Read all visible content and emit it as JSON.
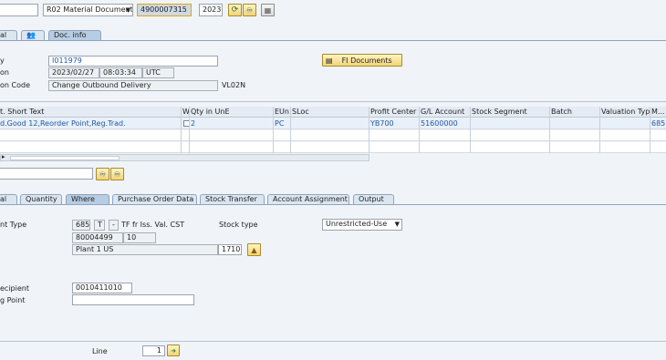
{
  "toolbar": {
    "action_value": "R02 Material Document",
    "document_number": "4900007315",
    "year": "2023"
  },
  "header_tabs": [
    {
      "label": "al"
    },
    {
      "label": ""
    },
    {
      "label": "Doc. info"
    }
  ],
  "doc_info": {
    "user_label": "y",
    "user_value": "I011979",
    "date_label": "on",
    "date_value": "2023/02/27",
    "time_value": "08:03:34",
    "tz_value": "UTC",
    "tcode_label": "on Code",
    "tcode_desc": "Change Outbound Delivery",
    "tcode": "VL02N",
    "fi_button": "FI Documents"
  },
  "items_table": {
    "columns": [
      "t. Short Text",
      "W",
      "Qty in UnE",
      "EUn",
      "SLoc",
      "Profit Center",
      "G/L Account",
      "Stock Segment",
      "Batch",
      "Valuation Type",
      "M..."
    ],
    "row": {
      "short_text": "d.Good 12,Reorder Point,Reg.Trad.",
      "qty": "2",
      "eun": "PC",
      "profit_center": "YB700",
      "gl_account": "51600000",
      "m": "685"
    }
  },
  "detail_tabs": [
    {
      "label": "al"
    },
    {
      "label": "Quantity"
    },
    {
      "label": "Where"
    },
    {
      "label": "Purchase Order Data"
    },
    {
      "label": "Stock Transfer"
    },
    {
      "label": "Account Assignment"
    },
    {
      "label": "Output"
    }
  ],
  "where": {
    "mvt_label": "nt Type",
    "mvt_code": "685",
    "mvt_t": "T",
    "mvt_dash": "-",
    "mvt_desc": "TF fr Iss. Val. CST",
    "stock_type_label": "Stock type",
    "stock_type_value": "Unrestricted-Use",
    "material": "80004499",
    "material_item": "10",
    "plant_name": "Plant 1 US",
    "plant_code": "1710",
    "recipient_label": "ecipient",
    "recipient_value": "0010411010",
    "unloading_label": "g Point",
    "unloading_value": ""
  },
  "footer": {
    "line_label": "Line",
    "line_value": "1"
  },
  "colors": {
    "background": "#f0f4f9",
    "button": "#f0d477",
    "link_blue": "#2458a6"
  }
}
